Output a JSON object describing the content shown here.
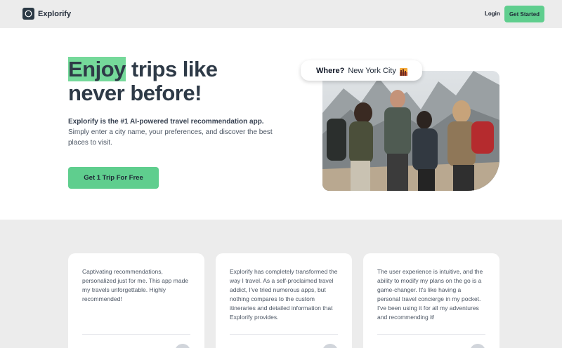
{
  "header": {
    "brand": "Explorify",
    "login_label": "Login",
    "get_started_label": "Get Started"
  },
  "hero": {
    "title_highlight": "Enjoy",
    "title_rest": " trips like never before!",
    "lead_bold": "Explorify is the #1 AI-powered travel recommendation app.",
    "lead_rest": "Simply enter a city name, your preferences, and discover the best places to visit.",
    "cta_label": "Get 1 Trip For Free",
    "search": {
      "label": "Where?",
      "value": "New York City",
      "icon": "city-sunset-icon"
    }
  },
  "testimonials": [
    {
      "text": "Captivating recommendations, personalized just for me. This app made my travels unforgettable. Highly recommended!"
    },
    {
      "text": "Explorify has completely transformed the way I travel. As a self-proclaimed travel addict, I've tried numerous apps, but nothing compares to the custom itineraries and detailed information that Explorify provides."
    },
    {
      "text": "The user experience is intuitive, and the ability to modify my plans on the go is a game-changer. It's like having a personal travel concierge in my pocket. I've been using it for all my adventures and recommending it!"
    }
  ],
  "colors": {
    "accent": "#5fce8e",
    "highlight": "#75d99a",
    "band": "#ececec",
    "text_dark": "#2e3a47"
  }
}
